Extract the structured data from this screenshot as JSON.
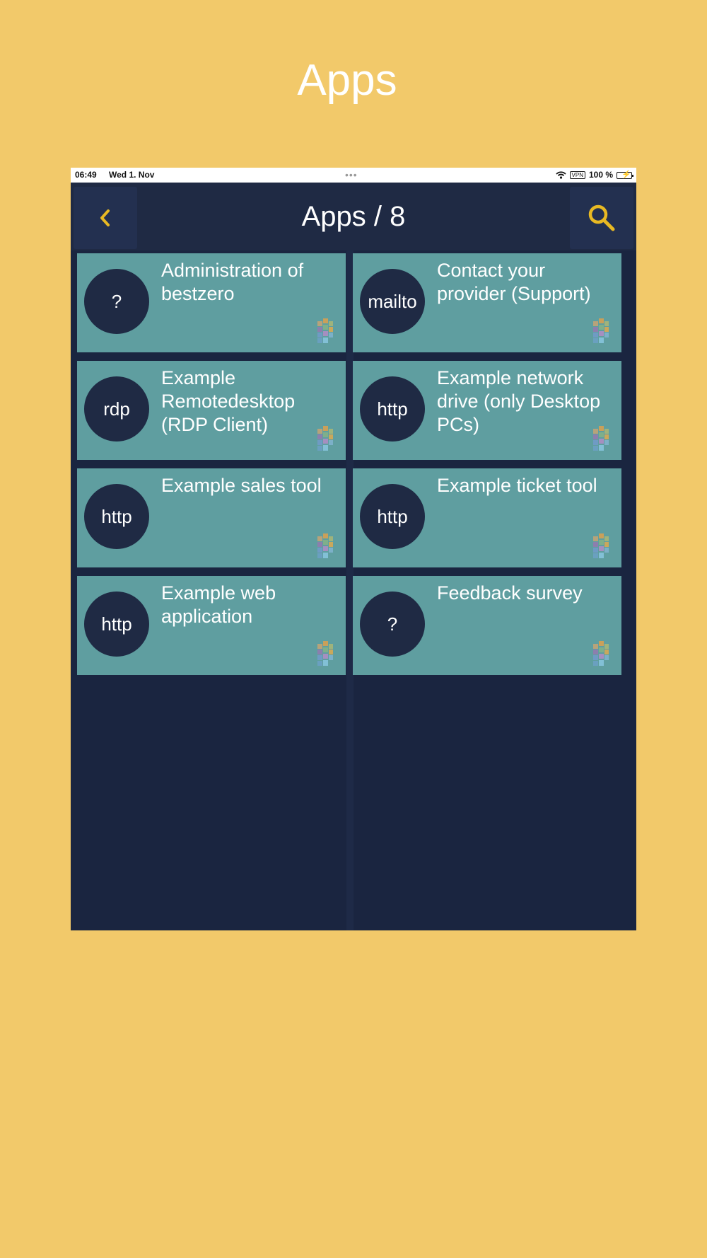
{
  "page": {
    "heading": "Apps"
  },
  "status_bar": {
    "time": "06:49",
    "date": "Wed 1. Nov",
    "dots": "•••",
    "vpn": "VPN",
    "battery": "100 %"
  },
  "header": {
    "title": "Apps / 8",
    "back_icon": "chevron-left-icon",
    "search_icon": "search-icon",
    "accent_color": "#e8b923"
  },
  "apps": [
    {
      "icon_text": "?",
      "label": "Administration of bestzero"
    },
    {
      "icon_text": "mailto",
      "label": "Contact your provider (Support)"
    },
    {
      "icon_text": "rdp",
      "label": "Example Remotedesktop (RDP Client)"
    },
    {
      "icon_text": "http",
      "label": "Example network drive (only Desktop PCs)"
    },
    {
      "icon_text": "http",
      "label": "Example sales tool"
    },
    {
      "icon_text": "http",
      "label": "Example ticket tool"
    },
    {
      "icon_text": "http",
      "label": "Example web application"
    },
    {
      "icon_text": "?",
      "label": "Feedback survey"
    }
  ],
  "colors": {
    "page_background": "#f2c96a",
    "app_background": "#1a2540",
    "tile": "#5f9ea0",
    "circle": "#1f2a44"
  }
}
